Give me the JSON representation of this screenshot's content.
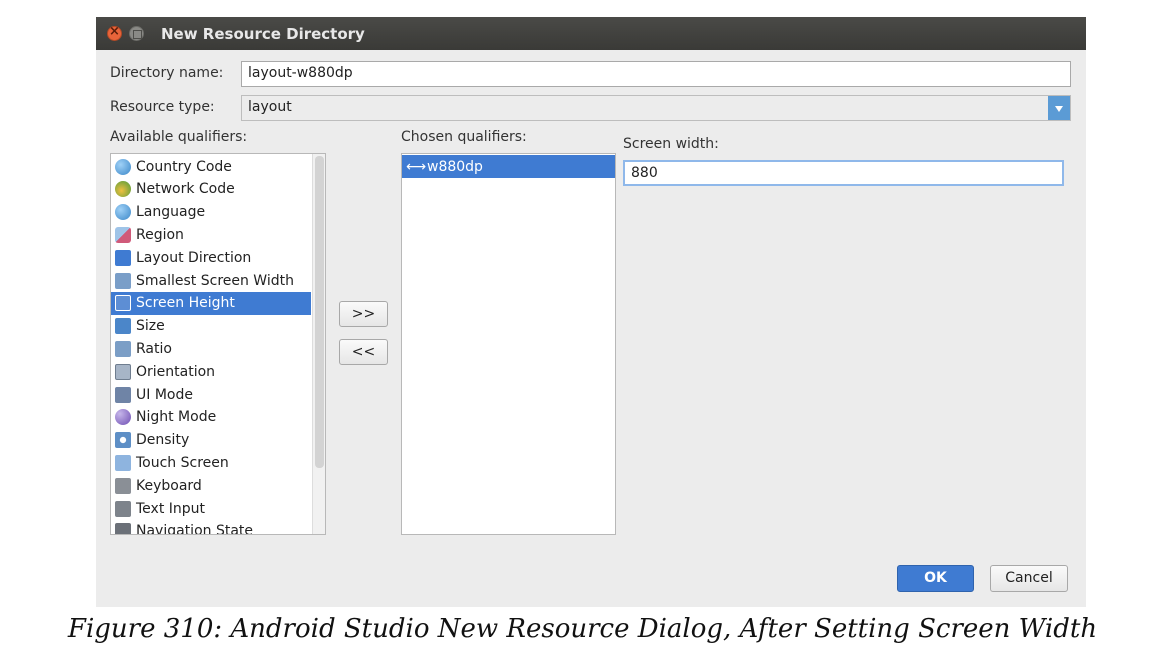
{
  "window": {
    "title": "New Resource Directory"
  },
  "directory_name": {
    "label": "Directory name:",
    "value": "layout-w880dp"
  },
  "resource_type": {
    "label": "Resource type:",
    "value": "layout"
  },
  "available": {
    "label": "Available qualifiers:",
    "items": [
      {
        "label": "Country Code",
        "icon": "globe-icon"
      },
      {
        "label": "Network Code",
        "icon": "network-icon"
      },
      {
        "label": "Language",
        "icon": "globe-icon"
      },
      {
        "label": "Region",
        "icon": "region-icon"
      },
      {
        "label": "Layout Direction",
        "icon": "direction-icon"
      },
      {
        "label": "Smallest Screen Width",
        "icon": "width-icon"
      },
      {
        "label": "Screen Height",
        "icon": "height-icon",
        "selected": true
      },
      {
        "label": "Size",
        "icon": "size-icon"
      },
      {
        "label": "Ratio",
        "icon": "ratio-icon"
      },
      {
        "label": "Orientation",
        "icon": "orientation-icon"
      },
      {
        "label": "UI Mode",
        "icon": "ui-mode-icon"
      },
      {
        "label": "Night Mode",
        "icon": "night-mode-icon"
      },
      {
        "label": "Density",
        "icon": "density-icon"
      },
      {
        "label": "Touch Screen",
        "icon": "touch-icon"
      },
      {
        "label": "Keyboard",
        "icon": "keyboard-icon"
      },
      {
        "label": "Text Input",
        "icon": "text-input-icon"
      },
      {
        "label": "Navigation State",
        "icon": "navigation-icon"
      }
    ]
  },
  "chosen": {
    "label": "Chosen qualifiers:",
    "items": [
      {
        "label": "w880dp",
        "icon": "width-arrow-icon",
        "selected": true
      }
    ]
  },
  "buttons": {
    "add": ">>",
    "remove": "<<",
    "ok": "OK",
    "cancel": "Cancel"
  },
  "screen_width": {
    "label": "Screen width:",
    "value": "880"
  },
  "caption": "Figure 310: Android Studio New Resource Dialog, After Setting Screen Width",
  "colors": {
    "selection": "#3f7bd2",
    "titlebar": "#3c3b37",
    "dialog_bg": "#ececec"
  }
}
